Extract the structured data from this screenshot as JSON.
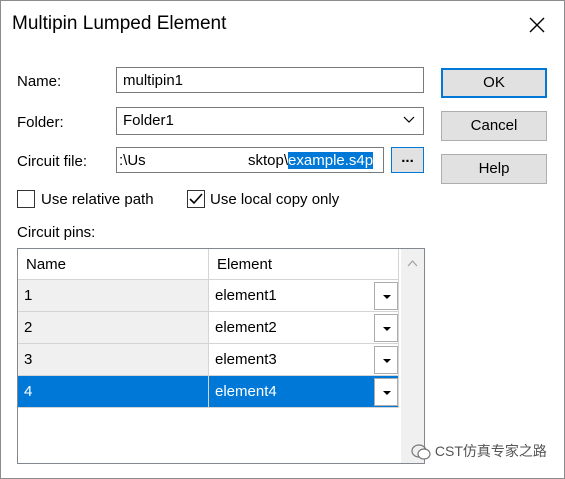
{
  "window": {
    "title": "Multipin Lumped Element",
    "close_icon": "close-icon"
  },
  "fields": {
    "name_label": "Name:",
    "name_value": "multipin1",
    "folder_label": "Folder:",
    "folder_value": "Folder1",
    "circuit_file_label": "Circuit file:",
    "circuit_file_prefix": ":\\Us",
    "circuit_file_mid": "sktop\\",
    "circuit_file_selected": "example.s4p",
    "browse_label": "..."
  },
  "buttons": {
    "ok": "OK",
    "cancel": "Cancel",
    "help": "Help"
  },
  "options": {
    "relative_path_label": "Use relative path",
    "relative_path_checked": false,
    "local_copy_label": "Use local copy only",
    "local_copy_checked": true
  },
  "pins": {
    "label": "Circuit pins:",
    "columns": [
      "Name",
      "Element"
    ],
    "rows": [
      {
        "name": "1",
        "element": "element1"
      },
      {
        "name": "2",
        "element": "element2"
      },
      {
        "name": "3",
        "element": "element3"
      },
      {
        "name": "4",
        "element": "element4"
      }
    ],
    "selected_row": 4
  },
  "watermark": "CST仿真专家之路",
  "colors": {
    "accent": "#0078d7",
    "button_bg": "#e1e1e1",
    "grid_bg": "#f0f0f0"
  }
}
